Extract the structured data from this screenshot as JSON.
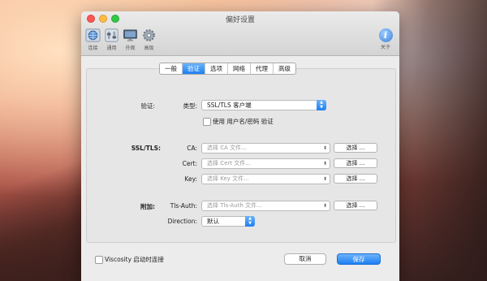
{
  "window": {
    "title": "偏好设置"
  },
  "toolbar": {
    "items": [
      {
        "label": "连接",
        "icon": "globe-icon"
      },
      {
        "label": "通用",
        "icon": "switch-icon"
      },
      {
        "label": "外观",
        "icon": "monitor-icon"
      },
      {
        "label": "高级",
        "icon": "gear-icon"
      }
    ],
    "about": {
      "label": "关于",
      "icon": "info-icon",
      "glyph": "i"
    }
  },
  "tabs": [
    {
      "label": "一般",
      "active": false
    },
    {
      "label": "验证",
      "active": true
    },
    {
      "label": "选项",
      "active": false
    },
    {
      "label": "网络",
      "active": false
    },
    {
      "label": "代理",
      "active": false
    },
    {
      "label": "高级",
      "active": false
    }
  ],
  "auth": {
    "section_label": "验证:",
    "type_label": "类型:",
    "type_value": "SSL/TLS 客户端",
    "userpass_label": "使用 用户名/密码 验证",
    "userpass_checked": false
  },
  "ssl": {
    "section_label": "SSL/TLS:",
    "ca_label": "CA:",
    "ca_placeholder": "选择 CA 文件...",
    "cert_label": "Cert:",
    "cert_placeholder": "选择 Cert 文件...",
    "key_label": "Key:",
    "key_placeholder": "选择 Key 文件...",
    "choose_button": "选择 ..."
  },
  "extra": {
    "section_label": "附加:",
    "tlsauth_label": "Tls-Auth:",
    "tlsauth_placeholder": "选择 Tls-Auth 文件...",
    "direction_label": "Direction:",
    "direction_value": "默认"
  },
  "footer": {
    "startup_label": "Viscosity 启动时连接",
    "startup_checked": false,
    "cancel": "取消",
    "save": "保存"
  },
  "colors": {
    "accent": "#1d7ff2",
    "close": "#fc5753",
    "minimize": "#fdbc40",
    "maximize": "#33c748"
  }
}
